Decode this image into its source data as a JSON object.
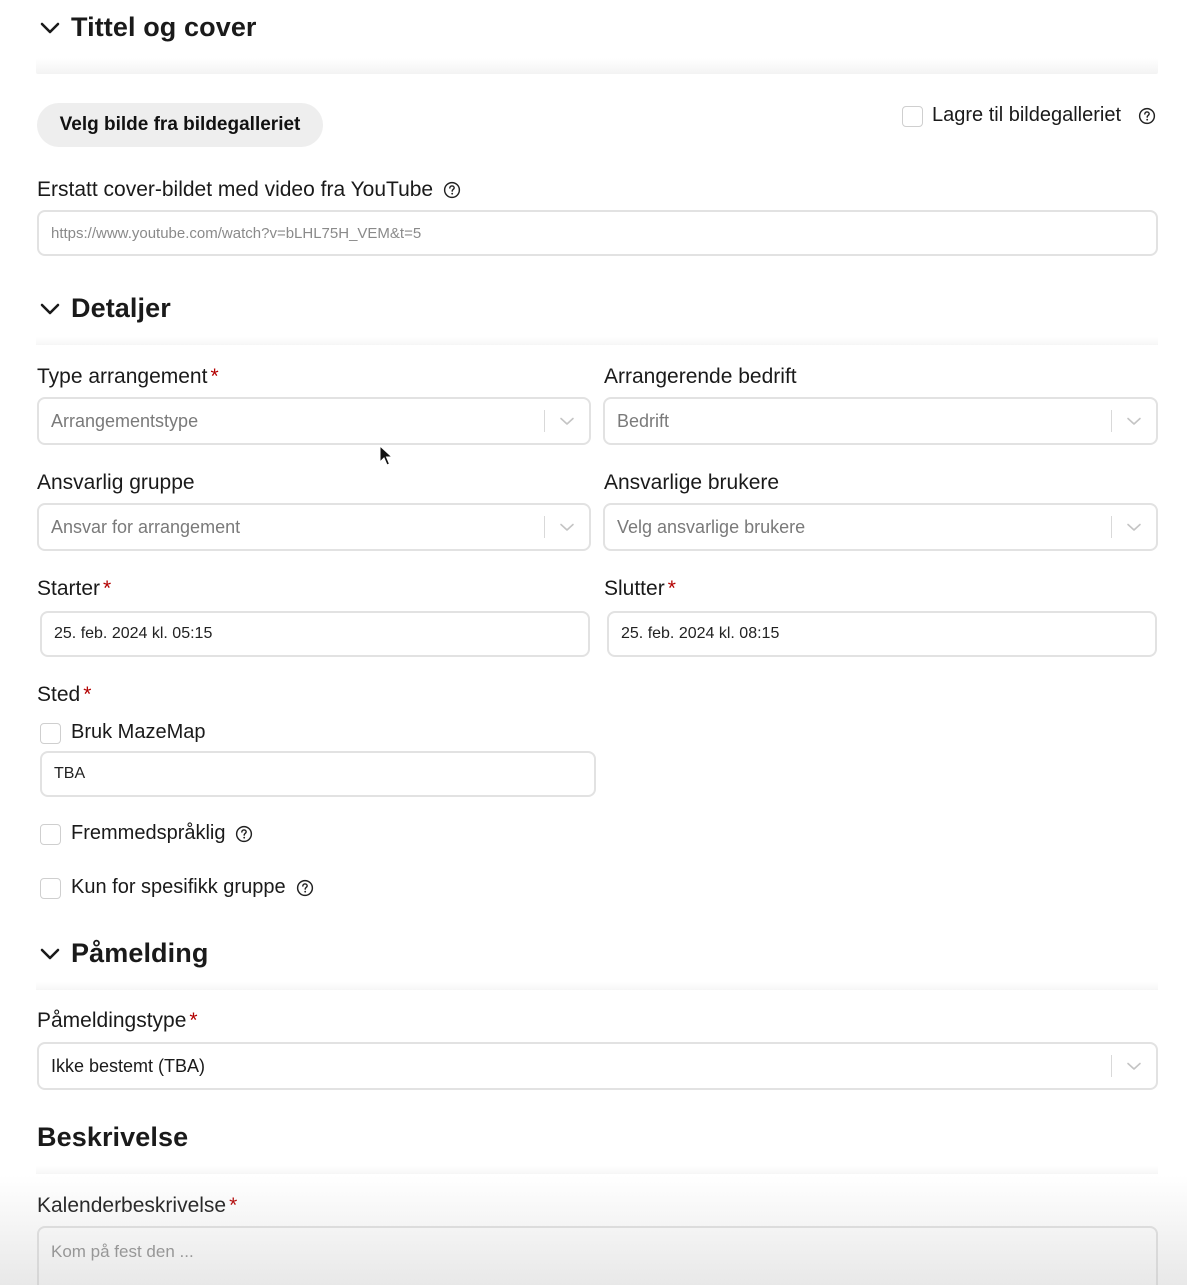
{
  "title_cover": {
    "heading": "Tittel og cover",
    "gallery_button": "Velg bilde fra bildegalleriet",
    "save_to_gallery_label": "Lagre til bildegalleriet",
    "youtube_label": "Erstatt cover-bildet med video fra YouTube",
    "youtube_placeholder": "https://www.youtube.com/watch?v=bLHL75H_VEM&t=5"
  },
  "details": {
    "heading": "Detaljer",
    "event_type_label": "Type arrangement",
    "event_type_placeholder": "Arrangementstype",
    "company_label": "Arrangerende bedrift",
    "company_placeholder": "Bedrift",
    "group_label": "Ansvarlig gruppe",
    "group_placeholder": "Ansvar for arrangement",
    "users_label": "Ansvarlige brukere",
    "users_placeholder": "Velg ansvarlige brukere",
    "start_label": "Starter",
    "start_value": "25. feb. 2024 kl. 05:15",
    "end_label": "Slutter",
    "end_value": "25. feb. 2024 kl. 08:15",
    "location_label": "Sted",
    "mazemap_label": "Bruk MazeMap",
    "location_value": "TBA",
    "foreign_language_label": "Fremmedspråklig",
    "specific_group_label": "Kun for spesifikk gruppe",
    "required_marker": "*"
  },
  "registration": {
    "heading": "Påmelding",
    "type_label": "Påmeldingstype",
    "type_value": "Ikke bestemt (TBA)"
  },
  "description": {
    "heading": "Beskrivelse",
    "calendar_label": "Kalenderbeskrivelse",
    "calendar_placeholder": "Kom på fest den ..."
  },
  "icons": {
    "chevron": "chevron-down-icon",
    "help": "question-circle-icon",
    "cursor": "mouse-pointer-icon"
  }
}
